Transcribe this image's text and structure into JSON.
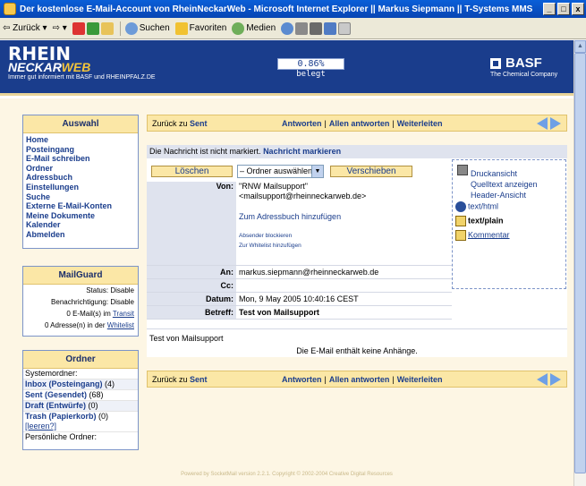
{
  "window": {
    "title": "Der kostenlose E-Mail-Account von RheinNeckarWeb - Microsoft Internet Explorer || Markus Siepmann || T-Systems MMS",
    "minimize": "_",
    "maximize": "□",
    "close": "x"
  },
  "toolbar": {
    "back": "Zurück",
    "search": "Suchen",
    "favorites": "Favoriten",
    "media": "Medien"
  },
  "header": {
    "logo_line1": "RHEIN",
    "logo_line2a": "NECKAR",
    "logo_line2b": "WEB",
    "logo_tagline": "Immer gut informiert mit BASF und RHEINPFALZ.DE",
    "quota_value": "0.86%",
    "quota_label": "belegt",
    "basf_name": "BASF",
    "basf_sub": "The Chemical Company"
  },
  "nav": {
    "title": "Auswahl",
    "items": [
      "Home",
      "Posteingang",
      "E-Mail schreiben",
      "Ordner",
      "Adressbuch",
      "Einstellungen",
      "Suche",
      "Externe E-Mail-Konten",
      "Meine Dokumente",
      "Kalender",
      "Abmelden"
    ]
  },
  "mailguard": {
    "title": "MailGuard",
    "status": "Status: Disable",
    "notify": "Benachrichtigung: Disable",
    "transit_prefix": "0 E-Mail(s) im",
    "transit_link": "Transit",
    "whitelist_prefix": "0 Adresse(n) in der",
    "whitelist_link": "Whitelist"
  },
  "folders": {
    "title": "Ordner",
    "system_label": "Systemordner:",
    "inbox": "Inbox (Posteingang)",
    "inbox_count": "(4)",
    "sent": "Sent (Gesendet)",
    "sent_count": "(68)",
    "draft": "Draft (Entwürfe)",
    "draft_count": "(0)",
    "trash": "Trash (Papierkorb)",
    "trash_count": "(0)",
    "empty_link": "[leeren?]",
    "personal_label": "Persönliche Ordner:"
  },
  "msgbar": {
    "back_prefix": "Zurück zu",
    "back_folder": "Sent",
    "reply": "Antworten",
    "reply_all": "Allen antworten",
    "forward": "Weiterleiten",
    "sep": "|"
  },
  "message": {
    "unmarked_text": "Die Nachricht ist nicht markiert.",
    "mark_link": "Nachricht markieren",
    "delete_btn": "Löschen",
    "folder_select": "– Ordner auswählen –",
    "move_btn": "Verschieben",
    "from_label": "Von:",
    "from_name": "\"RNW Mailsupport\"",
    "from_addr": "<mailsupport@rheinneckarweb.de>",
    "add_addressbook": "Zum Adressbuch hinzufügen",
    "block_sender": "Absender blockieren",
    "add_whitelist": "Zur Whitelist hinzufügen",
    "to_label": "An:",
    "to_value": "markus.siepmann@rheinneckarweb.de",
    "cc_label": "Cc:",
    "cc_value": "",
    "date_label": "Datum:",
    "date_value": "Mon, 9 May 2005 10:40:16 CEST",
    "subject_label": "Betreff:",
    "subject_value": "Test von Mailsupport",
    "body": "Test von Mailsupport",
    "no_attachments": "Die E-Mail enthält keine Anhänge."
  },
  "sidebox": {
    "print": "Druckansicht",
    "source": "Quelltext anzeigen",
    "headers": "Header-Ansicht",
    "html": "text/html",
    "plain": "text/plain",
    "comment": "Kommentar"
  },
  "footer": {
    "text": "Powered by SocketMail version 2.2.1. Copyright © 2002-2004 Creative Digital Resources"
  }
}
